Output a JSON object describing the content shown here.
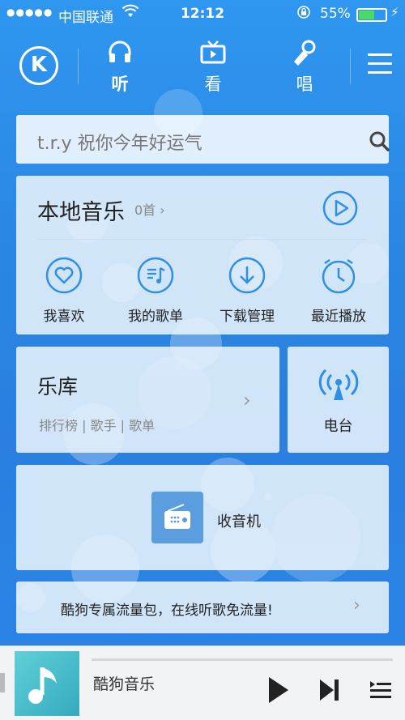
{
  "status_bar": {
    "signal": "●●●●●",
    "carrier": "中国联通",
    "time": "12:12",
    "battery_pct": "55%"
  },
  "top_nav": {
    "tabs": [
      {
        "label": "听",
        "icon": "headphones-icon",
        "active": true
      },
      {
        "label": "看",
        "icon": "tv-icon",
        "active": false
      },
      {
        "label": "唱",
        "icon": "microphone-icon",
        "active": false
      }
    ]
  },
  "search": {
    "placeholder": "t.r.y 祝你今年好运气"
  },
  "local_music": {
    "title": "本地音乐",
    "count": "0首",
    "quick_items": [
      {
        "label": "我喜欢",
        "icon": "heart-icon"
      },
      {
        "label": "我的歌单",
        "icon": "playlist-icon"
      },
      {
        "label": "下载管理",
        "icon": "download-icon"
      },
      {
        "label": "最近播放",
        "icon": "clock-icon"
      }
    ]
  },
  "library": {
    "title": "乐库",
    "sub": "排行榜 | 歌手 | 歌单"
  },
  "radio": {
    "label": "电台"
  },
  "fm": {
    "label": "收音机"
  },
  "promo": {
    "label": "酷狗专属流量包，在线听歌免流量!"
  },
  "player": {
    "song": "酷狗音乐"
  },
  "colors": {
    "accent": "#2a8ae6",
    "icon_blue": "#2f8fe6"
  }
}
